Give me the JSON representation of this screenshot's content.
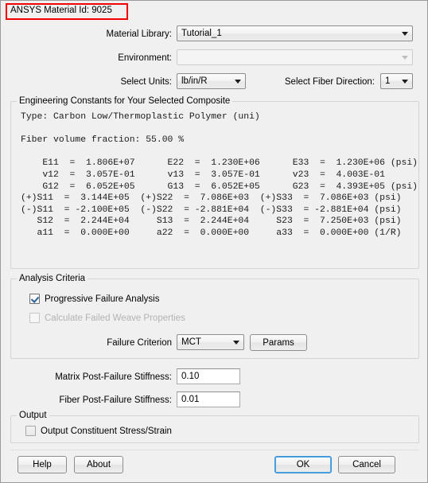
{
  "annotation": {
    "material_id_text": "ANSYS Material Id: 9025",
    "box_color": "#f40000"
  },
  "fields": {
    "material_library_label": "Material Library:",
    "material_library_value": "Tutorial_1",
    "environment_label": "Environment:",
    "environment_value": "",
    "select_units_label": "Select Units:",
    "select_units_value": "lb/in/R",
    "fiber_direction_label": "Select Fiber Direction:",
    "fiber_direction_value": "1"
  },
  "engineering_constants": {
    "group_title": "Engineering Constants for Your Selected Composite",
    "readout": "Type: Carbon Low/Thermoplastic Polymer (uni)\n\nFiber volume fraction: 55.00 %\n\n    E11  =  1.806E+07      E22  =  1.230E+06      E33  =  1.230E+06 (psi)\n    v12  =  3.057E-01      v13  =  3.057E-01      v23  =  4.003E-01\n    G12  =  6.052E+05      G13  =  6.052E+05      G23  =  4.393E+05 (psi)\n(+)S11  =  3.144E+05  (+)S22  =  7.086E+03  (+)S33  =  7.086E+03 (psi)\n(-)S11  = -2.100E+05  (-)S22  = -2.881E+04  (-)S33  = -2.881E+04 (psi)\n   S12  =  2.244E+04     S13  =  2.244E+04     S23  =  7.250E+03 (psi)\n   a11  =  0.000E+00     a22  =  0.000E+00     a33  =  0.000E+00 (1/R)",
    "type_line": "Type: Carbon Low/Thermoplastic Polymer (uni)",
    "fiber_volume_fraction": "Fiber volume fraction: 55.00 %",
    "rows": [
      {
        "c1_name": "E11",
        "c1_val": "1.806E+07",
        "c2_name": "E22",
        "c2_val": "1.230E+06",
        "c3_name": "E33",
        "c3_val": "1.230E+06",
        "units": "(psi)"
      },
      {
        "c1_name": "v12",
        "c1_val": "3.057E-01",
        "c2_name": "v13",
        "c2_val": "3.057E-01",
        "c3_name": "v23",
        "c3_val": "4.003E-01",
        "units": ""
      },
      {
        "c1_name": "G12",
        "c1_val": "6.052E+05",
        "c2_name": "G13",
        "c2_val": "6.052E+05",
        "c3_name": "G23",
        "c3_val": "4.393E+05",
        "units": "(psi)"
      },
      {
        "c1_name": "(+)S11",
        "c1_val": "3.144E+05",
        "c2_name": "(+)S22",
        "c2_val": "7.086E+03",
        "c3_name": "(+)S33",
        "c3_val": "7.086E+03",
        "units": "(psi)"
      },
      {
        "c1_name": "(-)S11",
        "c1_val": "-2.100E+05",
        "c2_name": "(-)S22",
        "c2_val": "-2.881E+04",
        "c3_name": "(-)S33",
        "c3_val": "-2.881E+04",
        "units": "(psi)"
      },
      {
        "c1_name": "S12",
        "c1_val": "2.244E+04",
        "c2_name": "S13",
        "c2_val": "2.244E+04",
        "c3_name": "S23",
        "c3_val": "7.250E+03",
        "units": "(psi)"
      },
      {
        "c1_name": "a11",
        "c1_val": "0.000E+00",
        "c2_name": "a22",
        "c2_val": "0.000E+00",
        "c3_name": "a33",
        "c3_val": "0.000E+00",
        "units": "(1/R)"
      }
    ]
  },
  "analysis_criteria": {
    "group_title": "Analysis Criteria",
    "progressive_failure_label": "Progressive Failure Analysis",
    "progressive_failure_checked": true,
    "calculate_failed_weave_label": "Calculate Failed Weave Properties",
    "calculate_failed_weave_checked": false,
    "failure_criterion_label": "Failure Criterion",
    "failure_criterion_value": "MCT",
    "params_button_label": "Params"
  },
  "stiffness": {
    "matrix_label": "Matrix Post-Failure Stiffness:",
    "matrix_value": "0.10",
    "fiber_label": "Fiber Post-Failure Stiffness:",
    "fiber_value": "0.01"
  },
  "output": {
    "group_title": "Output",
    "constituent_label": "Output Constituent Stress/Strain",
    "constituent_checked": false
  },
  "footer": {
    "help_label": "Help",
    "about_label": "About",
    "ok_label": "OK",
    "cancel_label": "Cancel"
  }
}
